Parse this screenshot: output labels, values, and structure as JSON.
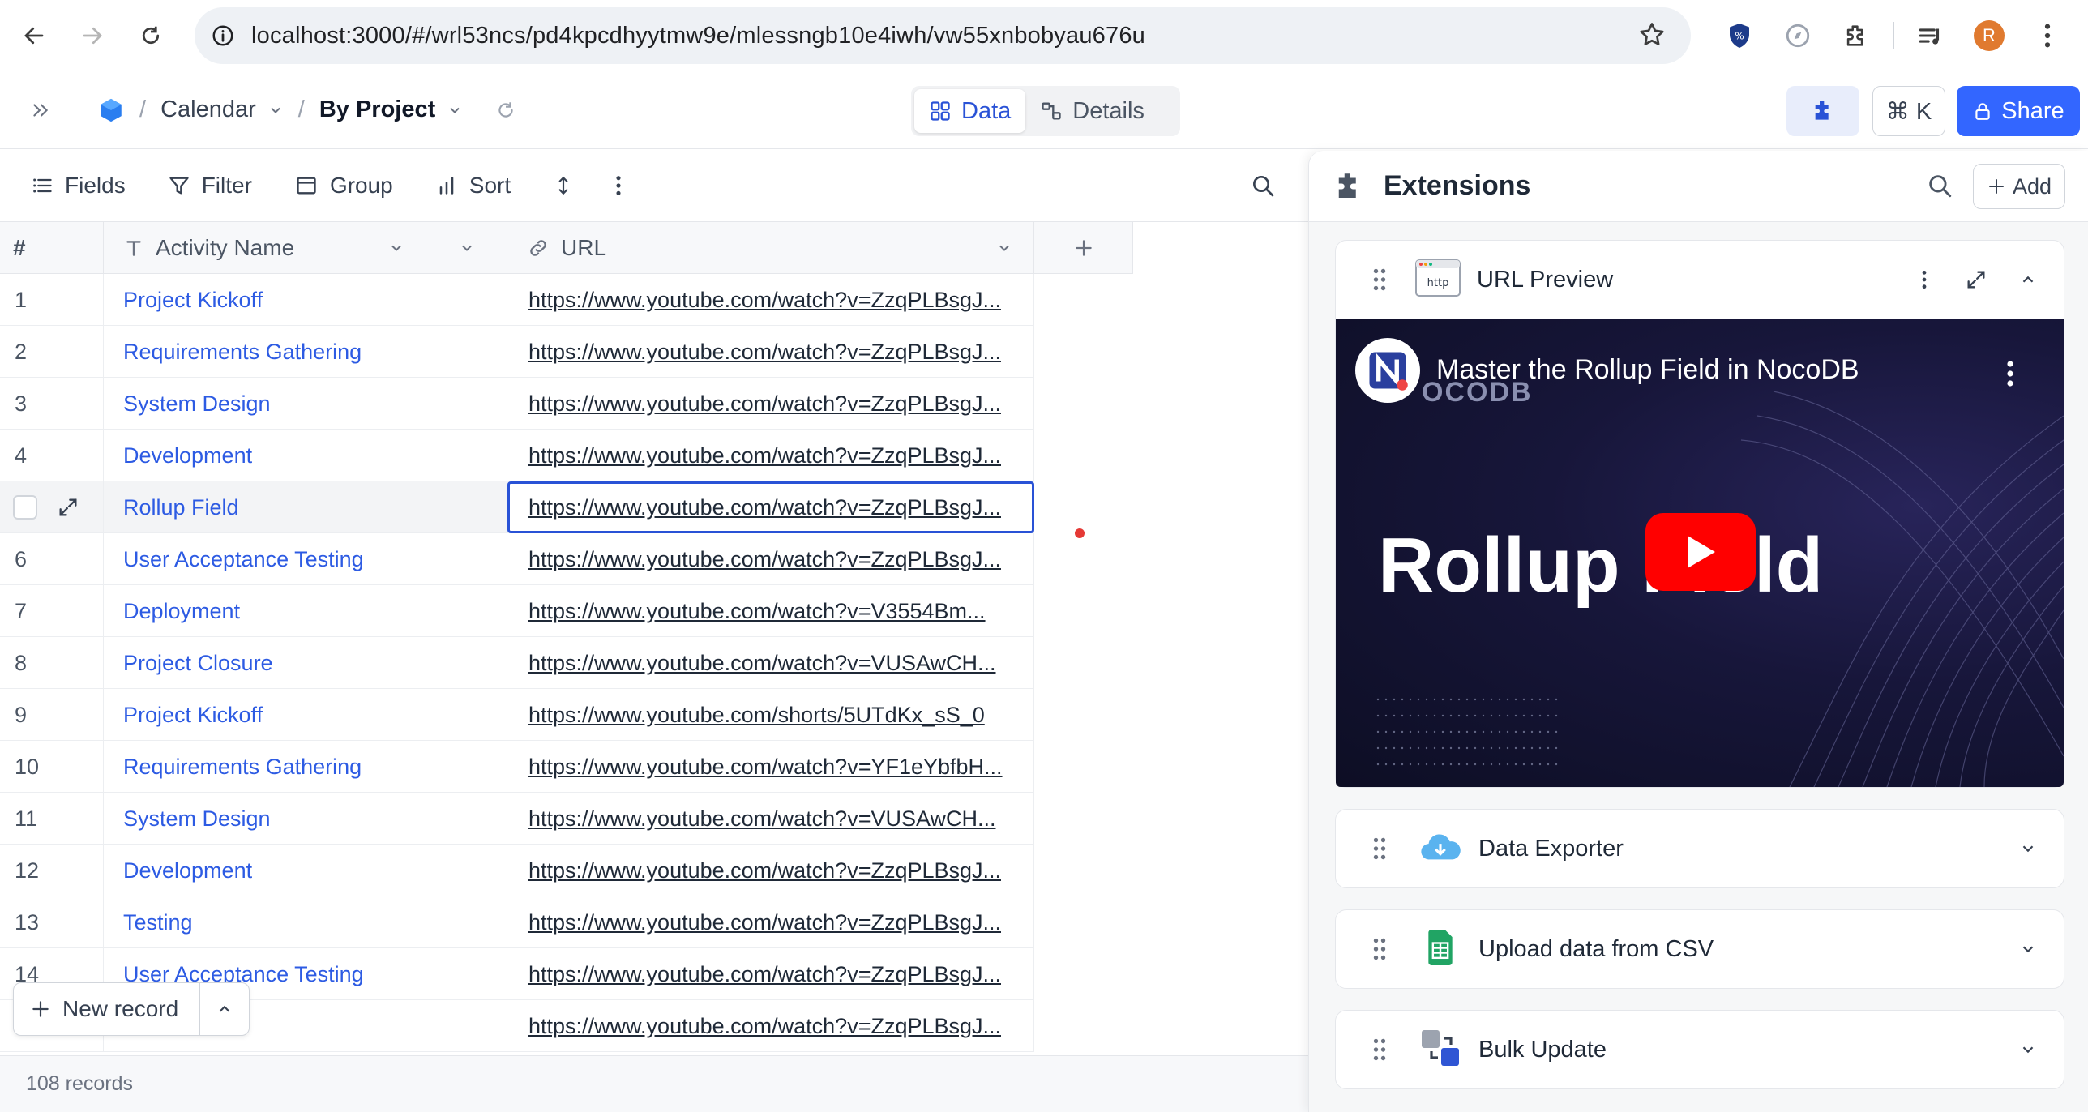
{
  "browser": {
    "url": "localhost:3000/#/wrl53ncs/pd4kpcdhyytmw9e/mlessngb10e4iwh/vw55xnbobyau676u",
    "profile_initial": "R"
  },
  "topbar": {
    "crumb_base": "Calendar",
    "crumb_view": "By Project",
    "tab_data": "Data",
    "tab_details": "Details",
    "shortcut": "⌘ K",
    "share": "Share"
  },
  "toolbar": {
    "fields": "Fields",
    "filter": "Filter",
    "group": "Group",
    "sort": "Sort"
  },
  "grid": {
    "col_hash": "#",
    "col_name": "Activity Name",
    "col_url": "URL",
    "rows": [
      {
        "n": "1",
        "name": "Project Kickoff",
        "url": "https://www.youtube.com/watch?v=ZzqPLBsgJ..."
      },
      {
        "n": "2",
        "name": "Requirements Gathering",
        "url": "https://www.youtube.com/watch?v=ZzqPLBsgJ..."
      },
      {
        "n": "3",
        "name": "System Design",
        "url": "https://www.youtube.com/watch?v=ZzqPLBsgJ..."
      },
      {
        "n": "4",
        "name": "Development",
        "url": "https://www.youtube.com/watch?v=ZzqPLBsgJ..."
      },
      {
        "n": "5",
        "name": "Rollup Field",
        "url": "https://www.youtube.com/watch?v=ZzqPLBsgJ..."
      },
      {
        "n": "6",
        "name": "User Acceptance Testing",
        "url": "https://www.youtube.com/watch?v=ZzqPLBsgJ..."
      },
      {
        "n": "7",
        "name": "Deployment",
        "url": "https://www.youtube.com/watch?v=V3554Bm..."
      },
      {
        "n": "8",
        "name": "Project Closure",
        "url": "https://www.youtube.com/watch?v=VUSAwCH..."
      },
      {
        "n": "9",
        "name": "Project Kickoff",
        "url": "https://www.youtube.com/shorts/5UTdKx_sS_0"
      },
      {
        "n": "10",
        "name": "Requirements Gathering",
        "url": "https://www.youtube.com/watch?v=YF1eYbfbH..."
      },
      {
        "n": "11",
        "name": "System Design",
        "url": "https://www.youtube.com/watch?v=VUSAwCH..."
      },
      {
        "n": "12",
        "name": "Development",
        "url": "https://www.youtube.com/watch?v=ZzqPLBsgJ..."
      },
      {
        "n": "13",
        "name": "Testing",
        "url": "https://www.youtube.com/watch?v=ZzqPLBsgJ..."
      },
      {
        "n": "14",
        "name": "User Acceptance Testing",
        "url": "https://www.youtube.com/watch?v=ZzqPLBsgJ..."
      },
      {
        "n": "",
        "name": "",
        "url": "https://www.youtube.com/watch?v=ZzqPLBsgJ..."
      }
    ],
    "new_record": "New record",
    "records_count": "108 records"
  },
  "extensions": {
    "title": "Extensions",
    "add": "Add",
    "url_preview": {
      "title": "URL Preview",
      "video_title": "Master the Rollup Field in NocoDB",
      "video_brand": "OCODB",
      "video_headline": "Rollup Field"
    },
    "data_exporter": "Data Exporter",
    "upload_csv": "Upload data from CSV",
    "bulk_update": "Bulk Update"
  },
  "colors": {
    "accent": "#3366ff",
    "link": "#2d5be3",
    "youtube_red": "#ff0000"
  }
}
